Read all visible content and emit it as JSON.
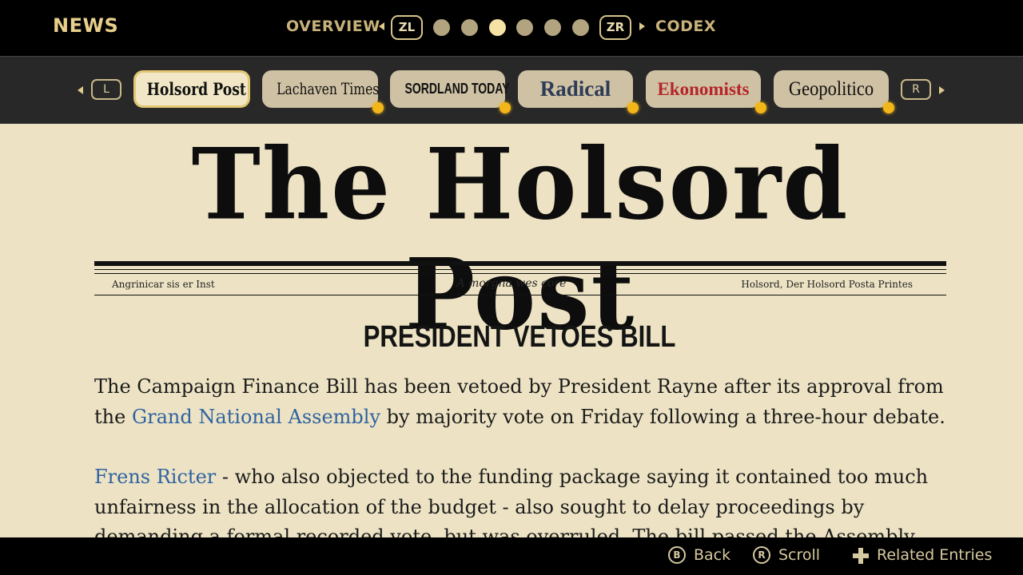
{
  "header": {
    "title": "NEWS",
    "left_section": "OVERVIEW",
    "right_section": "CODEX",
    "left_button": "ZL",
    "right_button": "ZR",
    "page_dots_count": 6,
    "active_dot_index": 2
  },
  "tabs": {
    "left_button": "L",
    "right_button": "R",
    "items": [
      {
        "label": "Holsord Post",
        "selected": true,
        "has_notification": false,
        "color": "#111111"
      },
      {
        "label": "Lachaven Times",
        "selected": false,
        "has_notification": true,
        "color": "#111111"
      },
      {
        "label": "SORDLAND TODAY",
        "selected": false,
        "has_notification": true,
        "color": "#111111"
      },
      {
        "label": "Radical",
        "selected": false,
        "has_notification": true,
        "color": "#2d3b57"
      },
      {
        "label": "Ekonomists",
        "selected": false,
        "has_notification": true,
        "color": "#b5252a",
        "accent_letter_color": "#b5252a"
      },
      {
        "label": "Geopolitico",
        "selected": false,
        "has_notification": true,
        "color": "#111111"
      }
    ]
  },
  "paper": {
    "masthead": "The Holsord Post",
    "subline_left": "Angrinicar sis er Inst",
    "subline_center": "A morgna wes core",
    "subline_right": "Holsord, Der Holsord Posta Printes",
    "headline": "PRESIDENT VETOES BILL",
    "para1": {
      "before": "The Campaign Finance Bill has been vetoed by President Rayne after its approval from the ",
      "link": "Grand National Assembly",
      "after": " by majority vote on Friday following a three-hour debate."
    },
    "para2": {
      "link": "Frens Ricter",
      "after": " - who also objected to the funding package saying it contained too much unfairness in the allocation of the budget - also sought to delay proceedings by demanding a formal recorded vote, but was overruled. The bill passed the Assembly"
    },
    "link_color": "#2f63a1"
  },
  "footer": {
    "back_button": "B",
    "back_label": "Back",
    "scroll_button": "R",
    "scroll_label": "Scroll",
    "related_label": "Related Entries"
  }
}
